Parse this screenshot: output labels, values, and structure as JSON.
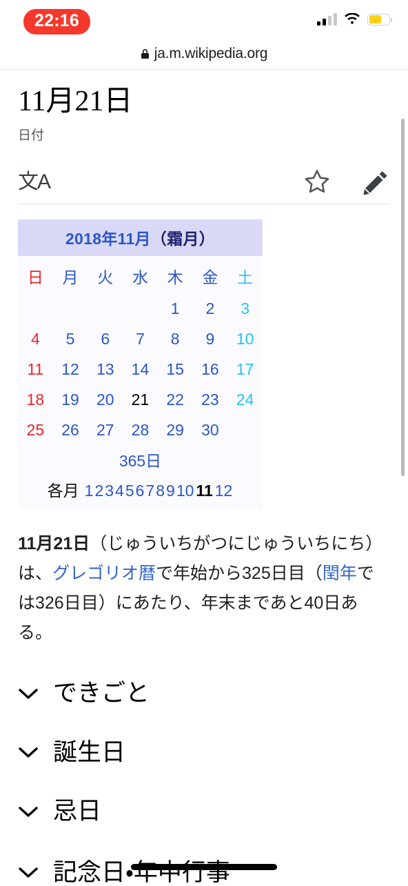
{
  "status_bar": {
    "time": "22:16",
    "recording_pill_color": "#f5382c",
    "signal_bars_filled": 2,
    "signal_bars_total": 4,
    "wifi": "wifi-icon",
    "battery_color": "#fdd216",
    "battery_level_percent": 62
  },
  "browser": {
    "lock_icon": "lock-icon",
    "host": "ja.m.wikipedia.org"
  },
  "article": {
    "title": "11月21日",
    "subtitle": "日付",
    "tools": {
      "language_label": "文A",
      "watch_icon": "star-outline-icon",
      "edit_icon": "pencil-icon"
    },
    "lead": {
      "bold_term": "11月21日",
      "part1": "（じゅういちがつにじゅういちにち）は、",
      "link1": "グレゴリオ暦",
      "part2": "で年始から325日目（",
      "link2": "閏年",
      "part3": "では326日目）にあたり、年末まであと40日ある。"
    },
    "sections": [
      {
        "label": "できごと",
        "icon": "chevron-down-icon"
      },
      {
        "label": "誕生日",
        "icon": "chevron-down-icon"
      },
      {
        "label": "忌日",
        "icon": "chevron-down-icon"
      },
      {
        "label": "記念日・年中行事",
        "icon": "chevron-down-icon"
      }
    ]
  },
  "calendar": {
    "header": {
      "year": "2018年",
      "month": "11月",
      "old_month_name": "（霜月）"
    },
    "weekdays": [
      {
        "label": "日",
        "kind": "sun"
      },
      {
        "label": "月",
        "kind": "wd"
      },
      {
        "label": "火",
        "kind": "wd"
      },
      {
        "label": "水",
        "kind": "wd"
      },
      {
        "label": "木",
        "kind": "wd"
      },
      {
        "label": "金",
        "kind": "wd"
      },
      {
        "label": "土",
        "kind": "sat"
      }
    ],
    "weeks": [
      [
        {
          "day": "",
          "kind": "sun"
        },
        {
          "day": "",
          "kind": "wd"
        },
        {
          "day": "",
          "kind": "wd"
        },
        {
          "day": "",
          "kind": "wd"
        },
        {
          "day": "1",
          "kind": "wd"
        },
        {
          "day": "2",
          "kind": "wd"
        },
        {
          "day": "3",
          "kind": "sat"
        }
      ],
      [
        {
          "day": "4",
          "kind": "sun"
        },
        {
          "day": "5",
          "kind": "wd"
        },
        {
          "day": "6",
          "kind": "wd"
        },
        {
          "day": "7",
          "kind": "wd"
        },
        {
          "day": "8",
          "kind": "wd"
        },
        {
          "day": "9",
          "kind": "wd"
        },
        {
          "day": "10",
          "kind": "sat"
        }
      ],
      [
        {
          "day": "11",
          "kind": "sun"
        },
        {
          "day": "12",
          "kind": "wd"
        },
        {
          "day": "13",
          "kind": "wd"
        },
        {
          "day": "14",
          "kind": "wd"
        },
        {
          "day": "15",
          "kind": "wd"
        },
        {
          "day": "16",
          "kind": "wd"
        },
        {
          "day": "17",
          "kind": "sat"
        }
      ],
      [
        {
          "day": "18",
          "kind": "sun"
        },
        {
          "day": "19",
          "kind": "wd"
        },
        {
          "day": "20",
          "kind": "wd"
        },
        {
          "day": "21",
          "kind": "today"
        },
        {
          "day": "22",
          "kind": "wd"
        },
        {
          "day": "23",
          "kind": "wd"
        },
        {
          "day": "24",
          "kind": "sat"
        }
      ],
      [
        {
          "day": "25",
          "kind": "sun"
        },
        {
          "day": "26",
          "kind": "wd"
        },
        {
          "day": "27",
          "kind": "wd"
        },
        {
          "day": "28",
          "kind": "wd"
        },
        {
          "day": "29",
          "kind": "wd"
        },
        {
          "day": "30",
          "kind": "wd"
        },
        {
          "day": "",
          "kind": "sat"
        }
      ]
    ],
    "footer_link": "365日",
    "months_label": "各月",
    "months": [
      "1",
      "2",
      "3",
      "4",
      "5",
      "6",
      "7",
      "8",
      "9",
      "10",
      "11",
      "12"
    ],
    "current_month": "11",
    "colors": {
      "header_bg": "#d9d9f7",
      "link": "#2b56c8",
      "sunday": "#e8282a",
      "saturday": "#24c4f4",
      "today": "#000000"
    }
  }
}
